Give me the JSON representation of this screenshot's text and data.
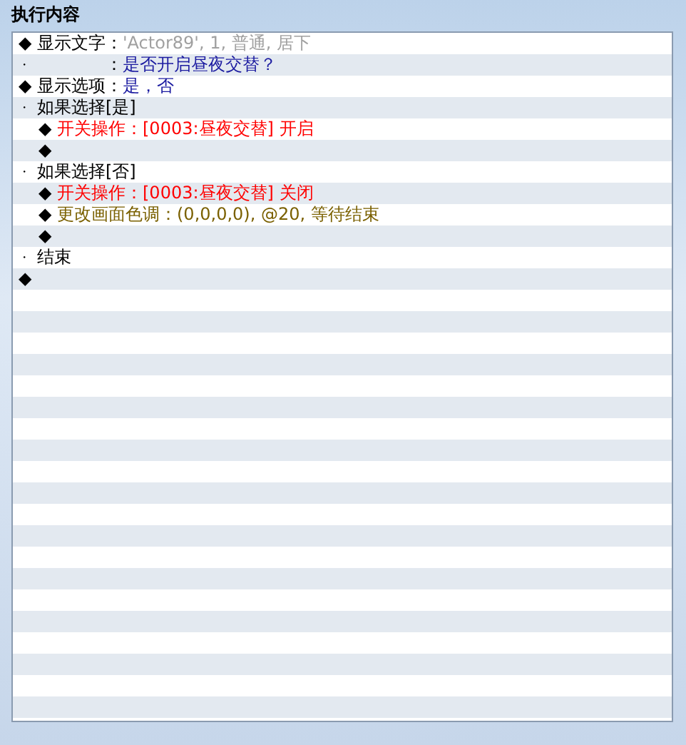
{
  "title": "执行内容",
  "lines": [
    {
      "kind": "command",
      "marker": "◆",
      "label": "显示文字：",
      "text": "'Actor89', 1, 普通, 居下",
      "color": "#a0a0a0"
    },
    {
      "kind": "continuation",
      "marker": "・",
      "label": "：",
      "text": "是否开启昼夜交替？",
      "color": "#1a1aa0"
    },
    {
      "kind": "command",
      "marker": "◆",
      "label": "显示选项：",
      "text": "是，否",
      "color": "#1a1aa0"
    },
    {
      "kind": "branch",
      "marker": "・",
      "label": "如果选择[是]",
      "children": [
        {
          "kind": "command",
          "marker": "◆",
          "text": "开关操作：[0003:昼夜交替] 开启",
          "color": "#ff0000"
        },
        {
          "kind": "command",
          "marker": "◆"
        }
      ]
    },
    {
      "kind": "branch",
      "marker": "・",
      "label": "如果选择[否]",
      "children": [
        {
          "kind": "command",
          "marker": "◆",
          "text": "开关操作：[0003:昼夜交替] 关闭",
          "color": "#ff0000"
        },
        {
          "kind": "command",
          "marker": "◆",
          "text": "更改画面色调：(0,0,0,0), @20, 等待结束",
          "color": "#7a6000"
        },
        {
          "kind": "command",
          "marker": "◆"
        }
      ]
    },
    {
      "kind": "branch",
      "marker": "・",
      "label": "结束"
    },
    {
      "kind": "command",
      "marker": "◆"
    }
  ]
}
